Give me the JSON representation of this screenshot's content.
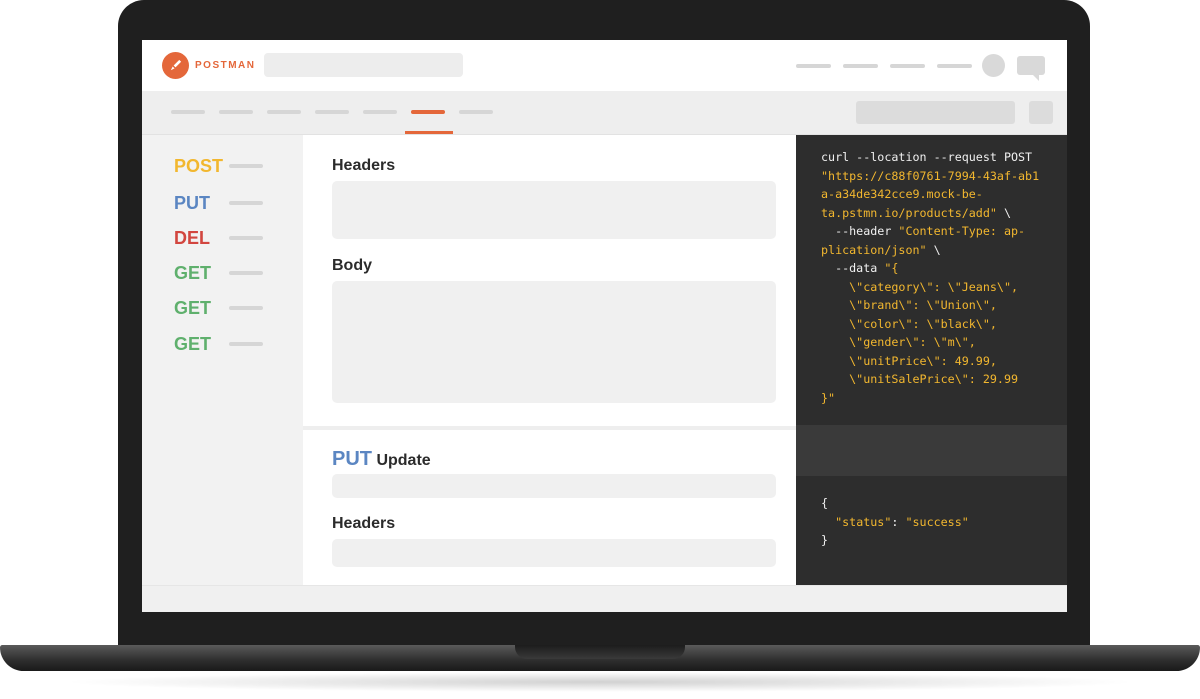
{
  "app": {
    "logo_text": "POSTMAN",
    "logo_icon": "rocket-icon",
    "accent_color": "#e4673a"
  },
  "sidebar": {
    "methods": [
      {
        "label": "POST",
        "color": "#f2b72f"
      },
      {
        "label": "PUT",
        "color": "#5b86c2"
      },
      {
        "label": "DEL",
        "color": "#d2463f"
      },
      {
        "label": "GET",
        "color": "#5fb06d"
      },
      {
        "label": "GET",
        "color": "#5fb06d"
      },
      {
        "label": "GET",
        "color": "#5fb06d"
      }
    ]
  },
  "main": {
    "headers_title": "Headers",
    "body_title": "Body",
    "put_method": "PUT",
    "put_title": "Update",
    "headers_title_2": "Headers"
  },
  "code": {
    "lines": [
      [
        {
          "t": "curl --location --request POST",
          "c": "w"
        }
      ],
      [
        {
          "t": "\"https://c88f0761-7994-43af-ab1",
          "c": "s"
        }
      ],
      [
        {
          "t": "a-a34de342cce9.mock-be-",
          "c": "s"
        }
      ],
      [
        {
          "t": "ta.pstmn.io/products/add\"",
          "c": "s"
        },
        {
          "t": " \\",
          "c": "w"
        }
      ],
      [
        {
          "t": "  --header ",
          "c": "w"
        },
        {
          "t": "\"Content-Type: ap-",
          "c": "s"
        }
      ],
      [
        {
          "t": "plication/json\"",
          "c": "s"
        },
        {
          "t": " \\",
          "c": "w"
        }
      ],
      [
        {
          "t": "  --data ",
          "c": "w"
        },
        {
          "t": "\"{",
          "c": "s"
        }
      ],
      [
        {
          "t": "    \\\"category\\\": \\\"Jeans\\\",",
          "c": "s"
        }
      ],
      [
        {
          "t": "    \\\"brand\\\": \\\"Union\\\",",
          "c": "s"
        }
      ],
      [
        {
          "t": "    \\\"color\\\": \\\"black\\\",",
          "c": "s"
        }
      ],
      [
        {
          "t": "    \\\"gender\\\": \\\"m\\\",",
          "c": "s"
        }
      ],
      [
        {
          "t": "    \\\"unitPrice\\\": 49.99,",
          "c": "s"
        }
      ],
      [
        {
          "t": "    \\\"unitSalePrice\\\": 29.99",
          "c": "s"
        }
      ],
      [
        {
          "t": "}\"",
          "c": "s"
        }
      ]
    ],
    "response": [
      [
        {
          "t": "{",
          "c": "w"
        }
      ],
      [
        {
          "t": "  ",
          "c": "w"
        },
        {
          "t": "\"status\"",
          "c": "s"
        },
        {
          "t": ": ",
          "c": "w"
        },
        {
          "t": "\"success\"",
          "c": "s"
        }
      ],
      [
        {
          "t": "}",
          "c": "w"
        }
      ]
    ]
  }
}
